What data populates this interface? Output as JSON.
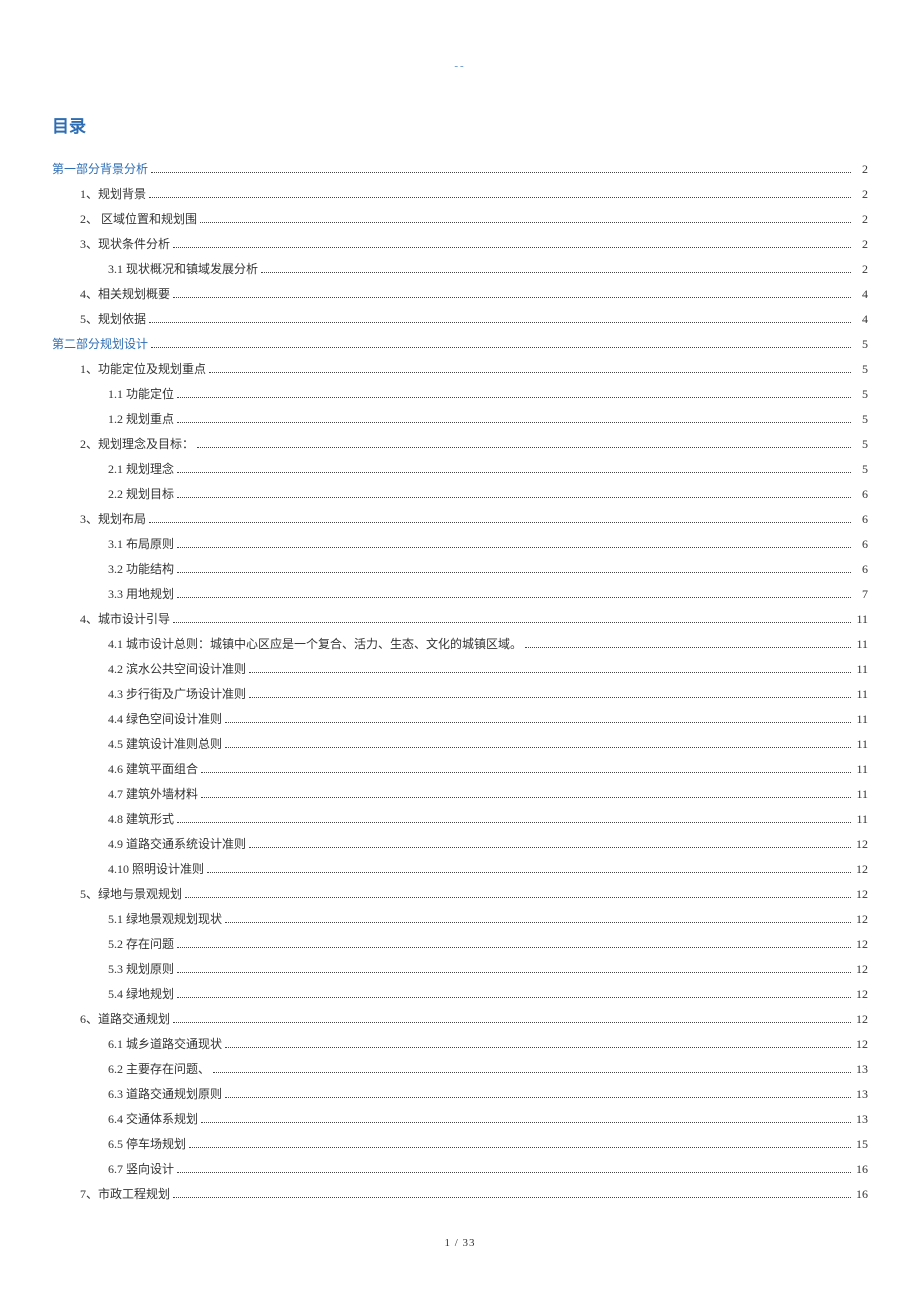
{
  "header_mark": "--",
  "toc_title": "目录",
  "footer": "1 / 33",
  "entries": [
    {
      "level": 0,
      "label": "第一部分背景分析",
      "page": "2"
    },
    {
      "level": 1,
      "label": "1、规划背景",
      "page": "2"
    },
    {
      "level": 1,
      "label": "2、 区域位置和规划围",
      "page": "2"
    },
    {
      "level": 1,
      "label": "3、现状条件分析",
      "page": "2"
    },
    {
      "level": 2,
      "label": "3.1 现状概况和镇域发展分析",
      "page": "2"
    },
    {
      "level": 1,
      "label": "4、相关规划概要",
      "page": "4"
    },
    {
      "level": 1,
      "label": "5、规划依据",
      "page": "4"
    },
    {
      "level": 0,
      "label": "第二部分规划设计",
      "page": "5"
    },
    {
      "level": 1,
      "label": "1、功能定位及规划重点",
      "page": "5"
    },
    {
      "level": 2,
      "label": "1.1 功能定位",
      "page": "5"
    },
    {
      "level": 2,
      "label": "1.2 规划重点",
      "page": "5"
    },
    {
      "level": 1,
      "label": "2、规划理念及目标：",
      "page": "5"
    },
    {
      "level": 2,
      "label": "2.1 规划理念",
      "page": "5"
    },
    {
      "level": 2,
      "label": "2.2 规划目标",
      "page": "6"
    },
    {
      "level": 1,
      "label": "3、规划布局",
      "page": "6"
    },
    {
      "level": 2,
      "label": "3.1 布局原则",
      "page": "6"
    },
    {
      "level": 2,
      "label": "3.2 功能结构",
      "page": "6"
    },
    {
      "level": 2,
      "label": "3.3 用地规划",
      "page": "7"
    },
    {
      "level": 1,
      "label": "4、城市设计引导",
      "page": "11"
    },
    {
      "level": 2,
      "label": "4.1  城市设计总则：城镇中心区应是一个复合、活力、生态、文化的城镇区域。",
      "page": "11"
    },
    {
      "level": 2,
      "label": "4.2  滨水公共空间设计准则",
      "page": "11"
    },
    {
      "level": 2,
      "label": "4.3 步行街及广场设计准则",
      "page": "11"
    },
    {
      "level": 2,
      "label": "4.4  绿色空间设计准则",
      "page": "11"
    },
    {
      "level": 2,
      "label": "4.5  建筑设计准则总则",
      "page": "11"
    },
    {
      "level": 2,
      "label": "4.6 建筑平面组合",
      "page": "11"
    },
    {
      "level": 2,
      "label": "4.7  建筑外墙材料",
      "page": "11"
    },
    {
      "level": 2,
      "label": "4.8  建筑形式",
      "page": "11"
    },
    {
      "level": 2,
      "label": "4.9  道路交通系统设计准则",
      "page": "12"
    },
    {
      "level": 2,
      "label": "4.10  照明设计准则",
      "page": "12"
    },
    {
      "level": 1,
      "label": "5、绿地与景观规划",
      "page": "12"
    },
    {
      "level": 2,
      "label": "5.1 绿地景观规划现状",
      "page": "12"
    },
    {
      "level": 2,
      "label": "5.2 存在问题",
      "page": "12"
    },
    {
      "level": 2,
      "label": "5.3 规划原则",
      "page": "12"
    },
    {
      "level": 2,
      "label": "5.4 绿地规划",
      "page": "12"
    },
    {
      "level": 1,
      "label": "6、道路交通规划",
      "page": "12"
    },
    {
      "level": 2,
      "label": "6.1 城乡道路交通现状",
      "page": "12"
    },
    {
      "level": 2,
      "label": "6.2 主要存在问题、",
      "page": "13"
    },
    {
      "level": 2,
      "label": "6.3 道路交通规划原则",
      "page": "13"
    },
    {
      "level": 2,
      "label": "6.4 交通体系规划",
      "page": "13"
    },
    {
      "level": 2,
      "label": "6.5 停车场规划",
      "page": "15"
    },
    {
      "level": 2,
      "label": "6.7 竖向设计",
      "page": "16"
    },
    {
      "level": 1,
      "label": "7、市政工程规划",
      "page": "16"
    }
  ]
}
